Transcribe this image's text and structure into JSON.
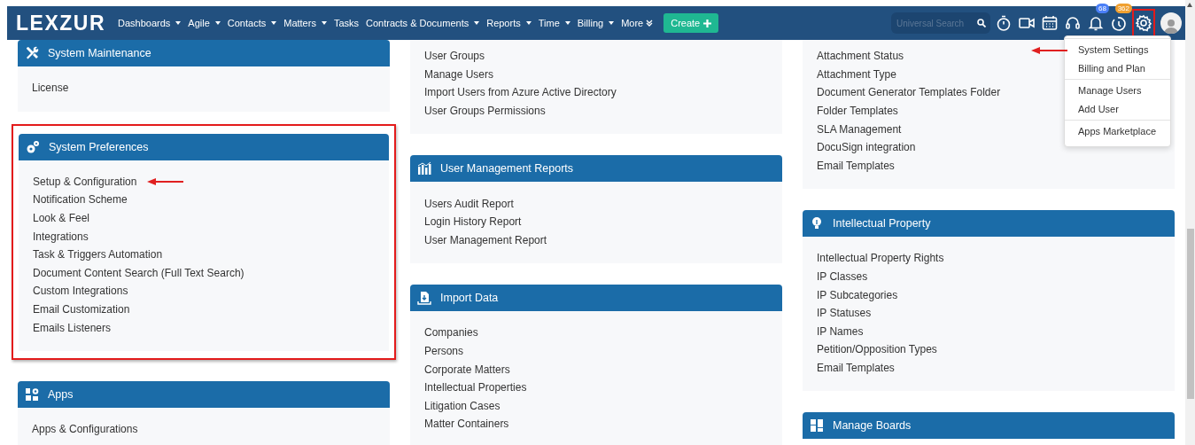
{
  "navbar": {
    "logo": "LEXZUR",
    "menu": [
      {
        "label": "Dashboards",
        "kind": "dropdown"
      },
      {
        "label": "Agile",
        "kind": "dropdown"
      },
      {
        "label": "Contacts",
        "kind": "dropdown"
      },
      {
        "label": "Matters",
        "kind": "dropdown"
      },
      {
        "label": "Tasks",
        "kind": "link"
      },
      {
        "label": "Contracts & Documents",
        "kind": "dropdown"
      },
      {
        "label": "Reports",
        "kind": "dropdown"
      },
      {
        "label": "Time",
        "kind": "dropdown"
      },
      {
        "label": "Billing",
        "kind": "dropdown"
      },
      {
        "label": "More",
        "kind": "expand"
      }
    ],
    "create": {
      "label": "Create"
    },
    "search": {
      "placeholder": "Universal Search"
    },
    "badges": {
      "notifications": "68",
      "reminders": "362"
    },
    "settings_highlighted": true
  },
  "settings_menu": {
    "groups": [
      {
        "items": [
          {
            "label": "System Settings",
            "pointed": true
          },
          {
            "label": "Billing and Plan",
            "pointed": false
          }
        ]
      },
      {
        "items": [
          {
            "label": "Manage Users",
            "pointed": false
          },
          {
            "label": "Add User",
            "pointed": false
          }
        ]
      },
      {
        "items": [
          {
            "label": "Apps Marketplace",
            "pointed": false
          }
        ]
      }
    ]
  },
  "columns": [
    {
      "cards": [
        {
          "title": "System Maintenance",
          "kind": "tools",
          "highlighted": false,
          "items": [
            {
              "label": "License",
              "pointed": false
            }
          ]
        },
        {
          "title": "System Preferences",
          "kind": "gears",
          "highlighted": true,
          "items": [
            {
              "label": "Setup & Configuration",
              "pointed": true
            },
            {
              "label": "Notification Scheme",
              "pointed": false
            },
            {
              "label": "Look & Feel",
              "pointed": false
            },
            {
              "label": "Integrations",
              "pointed": false
            },
            {
              "label": "Task & Triggers Automation",
              "pointed": false
            },
            {
              "label": "Document Content Search (Full Text Search)",
              "pointed": false
            },
            {
              "label": "Custom Integrations",
              "pointed": false
            },
            {
              "label": "Email Customization",
              "pointed": false
            },
            {
              "label": "Emails Listeners",
              "pointed": false
            }
          ]
        },
        {
          "title": "Apps",
          "kind": "apps",
          "highlighted": false,
          "items": [
            {
              "label": "Apps & Configurations",
              "pointed": false
            }
          ]
        }
      ]
    },
    {
      "cards": [
        {
          "kind": "continued",
          "highlighted": false,
          "items": [
            {
              "label": "User Groups",
              "pointed": false
            },
            {
              "label": "Manage Users",
              "pointed": false
            },
            {
              "label": "Import Users from Azure Active Directory",
              "pointed": false
            },
            {
              "label": "User Groups Permissions",
              "pointed": false
            }
          ]
        },
        {
          "title": "User Management Reports",
          "kind": "chart",
          "highlighted": false,
          "items": [
            {
              "label": "Users Audit Report",
              "pointed": false
            },
            {
              "label": "Login History Report",
              "pointed": false
            },
            {
              "label": "User Management Report",
              "pointed": false
            }
          ]
        },
        {
          "title": "Import Data",
          "kind": "import",
          "highlighted": false,
          "items": [
            {
              "label": "Companies",
              "pointed": false
            },
            {
              "label": "Persons",
              "pointed": false
            },
            {
              "label": "Corporate Matters",
              "pointed": false
            },
            {
              "label": "Intellectual Properties",
              "pointed": false
            },
            {
              "label": "Litigation Cases",
              "pointed": false
            },
            {
              "label": "Matter Containers",
              "pointed": false
            }
          ]
        }
      ]
    },
    {
      "cards": [
        {
          "kind": "continued",
          "highlighted": false,
          "items": [
            {
              "label": "Attachment Status",
              "pointed": false
            },
            {
              "label": "Attachment Type",
              "pointed": false
            },
            {
              "label": "Document Generator Templates Folder",
              "pointed": false
            },
            {
              "label": "Folder Templates",
              "pointed": false
            },
            {
              "label": "SLA Management",
              "pointed": false
            },
            {
              "label": "DocuSign integration",
              "pointed": false
            },
            {
              "label": "Email Templates",
              "pointed": false
            }
          ]
        },
        {
          "title": "Intellectual Property",
          "kind": "bulb",
          "highlighted": false,
          "items": [
            {
              "label": "Intellectual Property Rights",
              "pointed": false
            },
            {
              "label": "IP Classes",
              "pointed": false
            },
            {
              "label": "IP Subcategories",
              "pointed": false
            },
            {
              "label": "IP Statuses",
              "pointed": false
            },
            {
              "label": "IP Names",
              "pointed": false
            },
            {
              "label": "Petition/Opposition Types",
              "pointed": false
            },
            {
              "label": "Email Templates",
              "pointed": false
            }
          ]
        },
        {
          "title": "Manage Boards",
          "kind": "boards",
          "highlighted": false
        }
      ]
    }
  ]
}
